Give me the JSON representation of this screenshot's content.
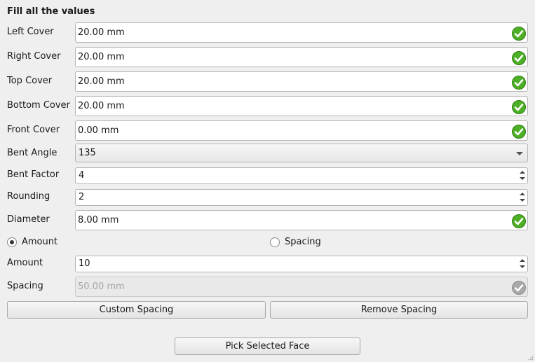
{
  "heading": "Fill all the values",
  "fields": {
    "left_cover": {
      "label": "Left Cover",
      "value": "20.00 mm"
    },
    "right_cover": {
      "label": "Right Cover",
      "value": "20.00 mm"
    },
    "top_cover": {
      "label": "Top Cover",
      "value": "20.00 mm"
    },
    "bottom_cover": {
      "label": "Bottom Cover",
      "value": "20.00 mm"
    },
    "front_cover": {
      "label": "Front Cover",
      "value": "0.00 mm"
    },
    "bent_angle": {
      "label": "Bent Angle",
      "value": "135"
    },
    "bent_factor": {
      "label": "Bent Factor",
      "value": "4"
    },
    "rounding": {
      "label": "Rounding",
      "value": "2"
    },
    "diameter": {
      "label": "Diameter",
      "value": "8.00 mm"
    },
    "amount": {
      "label": "Amount",
      "value": "10"
    },
    "spacing": {
      "label": "Spacing",
      "value": "50.00 mm"
    }
  },
  "mode": {
    "amount_label": "Amount",
    "spacing_label": "Spacing",
    "selected": "amount"
  },
  "buttons": {
    "custom_spacing": "Custom Spacing",
    "remove_spacing": "Remove Spacing",
    "pick_face": "Pick Selected Face"
  },
  "colors": {
    "valid_check": "#4caf25",
    "disabled_check": "#a8a8a8"
  }
}
